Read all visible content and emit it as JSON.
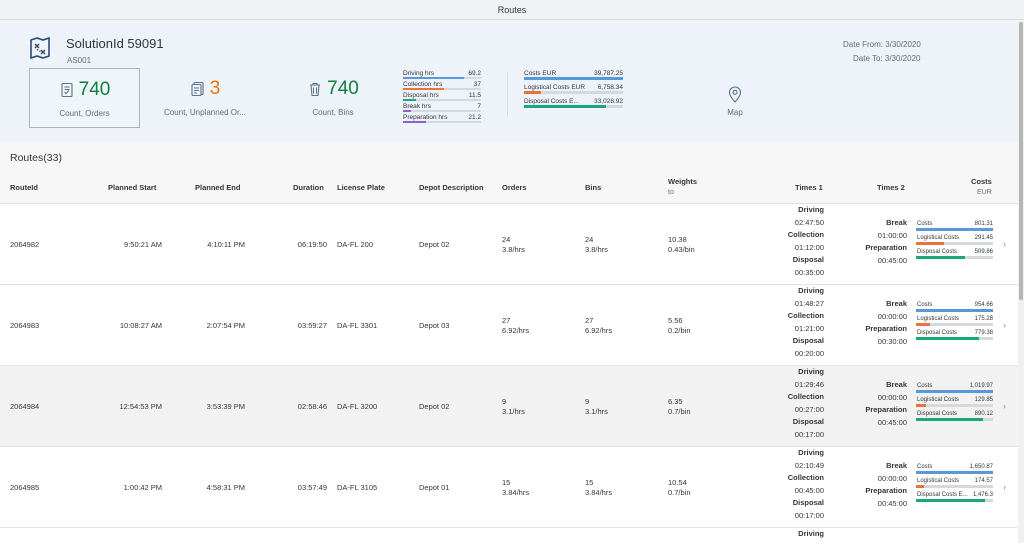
{
  "app": {
    "title": "Routes"
  },
  "header": {
    "title": "SolutionId 59091",
    "subtitle": "AS001",
    "date_from": "Date From: 3/30/2020",
    "date_to": "Date To: 3/30/2020",
    "icon": "route-map-icon"
  },
  "kpis": [
    {
      "value": "740",
      "label": "Count, Orders",
      "color": "#107e3e",
      "icon": "document-icon"
    },
    {
      "value": "3",
      "label": "Count, Unplanned Or...",
      "color": "#e9730c",
      "icon": "document-list-icon"
    },
    {
      "value": "740",
      "label": "Count, Bins",
      "color": "#107e3e",
      "icon": "trash-bin-icon"
    }
  ],
  "hours": [
    {
      "label": "Driving hrs",
      "value": "69.2",
      "fraction": 0.78,
      "color": "#5899da"
    },
    {
      "label": "Collection hrs",
      "value": "37",
      "fraction": 0.52,
      "color": "#e8743b"
    },
    {
      "label": "Disposal hrs",
      "value": "11.5",
      "fraction": 0.17,
      "color": "#19a979"
    },
    {
      "label": "Break hrs",
      "value": "7",
      "fraction": 0.1,
      "color": "#945ecf"
    },
    {
      "label": "Preparation hrs",
      "value": "21.2",
      "fraction": 0.3,
      "color": "#945ecf"
    }
  ],
  "cost_summary": [
    {
      "label": "Costs EUR",
      "value": "39,787.25",
      "fraction": 1.0,
      "color": "#5899da"
    },
    {
      "label": "Logistical Costs EUR",
      "value": "6,758.34",
      "fraction": 0.17,
      "color": "#e8743b"
    },
    {
      "label": "Disposal Costs E...",
      "value": "33,028.92",
      "fraction": 0.83,
      "color": "#19a979"
    }
  ],
  "map": {
    "label": "Map",
    "icon": "map-pin-icon"
  },
  "table": {
    "title": "Routes(33)",
    "columns": {
      "route_id": "RouteId",
      "planned_start": "Planned Start",
      "planned_end": "Planned End",
      "duration": "Duration",
      "license_plate": "License Plate",
      "depot": "Depot Description",
      "orders": "Orders",
      "bins": "Bins",
      "weights": "Weights",
      "weights_unit": "to",
      "times1": "Times 1",
      "times2": "Times 2",
      "costs": "Costs",
      "costs_unit": "EUR"
    },
    "labels": {
      "driving": "Driving",
      "collection": "Collection",
      "disposal": "Disposal",
      "break": "Break",
      "preparation": "Preparation",
      "costs": "Costs",
      "logistical_costs": "Logistical Costs",
      "disposal_costs": "Disposal Costs",
      "disposal_costs_short": "Disposal Costs E..."
    },
    "rows": [
      {
        "route_id": "2064982",
        "planned_start": "9:50:21 AM",
        "planned_end": "4:10:11 PM",
        "duration": "06:19:50",
        "license_plate": "DA-FL 200",
        "depot": "Depot 02",
        "orders": "24",
        "orders_rate": "3.8/hrs",
        "bins": "24",
        "bins_rate": "3.8/hrs",
        "weight": "10.38",
        "weight_rate": "0.43/bin",
        "driving": "02:47:50",
        "collection": "01:12:00",
        "disposal": "00:35:00",
        "break": "01:00:00",
        "preparation": "00:45:00",
        "costs": "801.31",
        "logistical_costs": "291.45",
        "disposal_costs": "509.86",
        "costs_frac": 1.0,
        "logistical_frac": 0.36,
        "disposal_frac": 0.64,
        "disposal_label_short": false
      },
      {
        "route_id": "2064983",
        "planned_start": "10:08:27 AM",
        "planned_end": "2:07:54 PM",
        "duration": "03:59:27",
        "license_plate": "DA-FL 3301",
        "depot": "Depot 03",
        "orders": "27",
        "orders_rate": "6.92/hrs",
        "bins": "27",
        "bins_rate": "6.92/hrs",
        "weight": "5.56",
        "weight_rate": "0.2/bin",
        "driving": "01:48:27",
        "collection": "01:21:00",
        "disposal": "00:20:00",
        "break": "00:00:00",
        "preparation": "00:30:00",
        "costs": "954.66",
        "logistical_costs": "175.28",
        "disposal_costs": "779.38",
        "costs_frac": 1.0,
        "logistical_frac": 0.18,
        "disposal_frac": 0.82,
        "disposal_label_short": false
      },
      {
        "route_id": "2064984",
        "planned_start": "12:54:53 PM",
        "planned_end": "3:53:39 PM",
        "duration": "02:58:46",
        "license_plate": "DA-FL 3200",
        "depot": "Depot 02",
        "orders": "9",
        "orders_rate": "3.1/hrs",
        "bins": "9",
        "bins_rate": "3.1/hrs",
        "weight": "6.35",
        "weight_rate": "0.7/bin",
        "driving": "01:29:46",
        "collection": "00:27:00",
        "disposal": "00:17:00",
        "break": "00:00:00",
        "preparation": "00:45:00",
        "costs": "1,019.97",
        "logistical_costs": "129.85",
        "disposal_costs": "890.12",
        "costs_frac": 1.0,
        "logistical_frac": 0.13,
        "disposal_frac": 0.87,
        "disposal_label_short": false
      },
      {
        "route_id": "2064985",
        "planned_start": "1:00:42 PM",
        "planned_end": "4:58:31 PM",
        "duration": "03:57:49",
        "license_plate": "DA-FL 3105",
        "depot": "Depot 01",
        "orders": "15",
        "orders_rate": "3.84/hrs",
        "bins": "15",
        "bins_rate": "3.84/hrs",
        "weight": "10.54",
        "weight_rate": "0.7/bin",
        "driving": "02:10:49",
        "collection": "00:45:00",
        "disposal": "00:17:00",
        "break": "00:00:00",
        "preparation": "00:45:00",
        "costs": "1,650.87",
        "logistical_costs": "174.57",
        "disposal_costs": "1,476.3",
        "costs_frac": 1.0,
        "logistical_frac": 0.11,
        "disposal_frac": 0.89,
        "disposal_label_short": true
      }
    ],
    "partial_row": {
      "driving": "Driving"
    }
  }
}
